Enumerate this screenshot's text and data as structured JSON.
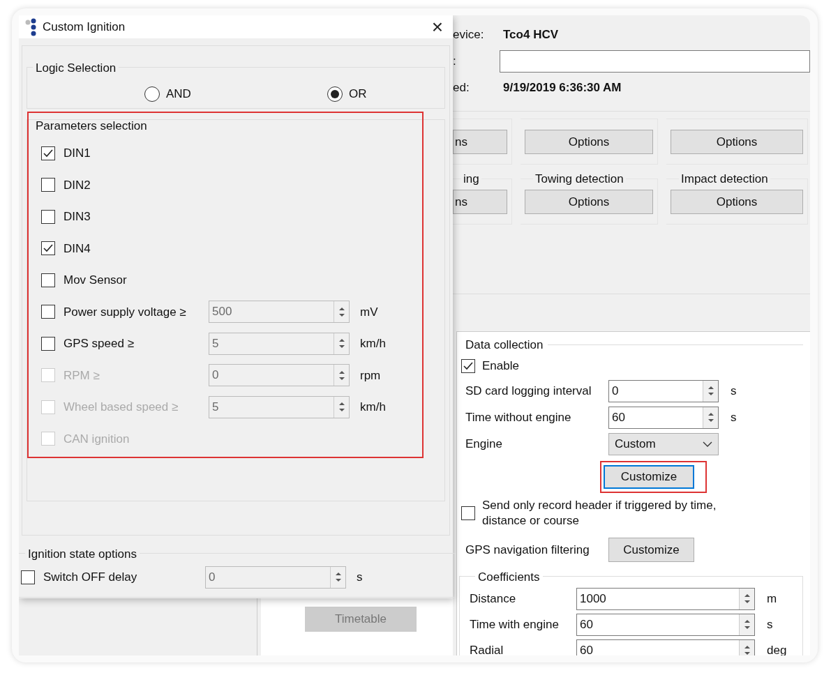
{
  "main": {
    "info": [
      {
        "kind": "text",
        "label": "evice:",
        "value": "Tco4 HCV"
      },
      {
        "kind": "input",
        "label": ":"
      },
      {
        "kind": "text",
        "label": "ed:",
        "value": "9/19/2019 6:36:30 AM"
      }
    ],
    "option_groups": [
      [
        {
          "button": "ns"
        },
        {
          "button": "Options"
        },
        {
          "button": "Options"
        }
      ],
      [
        {
          "title": "ing",
          "button": "ns"
        },
        {
          "title": "Towing detection",
          "button": "Options"
        },
        {
          "title": "Impact detection",
          "button": "Options"
        }
      ]
    ],
    "timetable": {
      "label": "Timetable",
      "disabled": true
    },
    "data_collection": {
      "title": "Data collection",
      "enable": {
        "label": "Enable",
        "checked": true
      },
      "fields": [
        {
          "kind": "spin",
          "label": "SD card logging interval",
          "value": "0",
          "unit": "s"
        },
        {
          "kind": "spin",
          "label": "Time without engine",
          "value": "60",
          "unit": "s"
        },
        {
          "kind": "combo",
          "label": "Engine",
          "value": "Custom"
        },
        {
          "kind": "button",
          "label": "Customize",
          "focused": true,
          "highlighted": true
        }
      ],
      "record_header": {
        "label": "Send only record header if triggered by time, distance or course",
        "checked": false
      },
      "gps_filtering": {
        "label": "GPS navigation filtering",
        "button": "Customize"
      },
      "coefficients": {
        "title": "Coefficients",
        "fields": [
          {
            "label": "Distance",
            "value": "1000",
            "unit": "m"
          },
          {
            "label": "Time with engine",
            "value": "60",
            "unit": "s"
          },
          {
            "label": "Radial",
            "value": "60",
            "unit": "deg"
          }
        ]
      }
    }
  },
  "dialog": {
    "title": "Custom Ignition",
    "close": "×",
    "logic": {
      "title": "Logic Selection",
      "options": [
        {
          "label": "AND",
          "selected": false
        },
        {
          "label": "OR",
          "selected": true
        }
      ]
    },
    "parameters": {
      "title": "Parameters selection",
      "highlighted": true,
      "items": [
        {
          "label": "DIN1",
          "checked": true,
          "disabled": false
        },
        {
          "label": "DIN2",
          "checked": false,
          "disabled": false
        },
        {
          "label": "DIN3",
          "checked": false,
          "disabled": false
        },
        {
          "label": "DIN4",
          "checked": true,
          "disabled": false
        },
        {
          "label": "Mov Sensor",
          "checked": false,
          "disabled": false
        },
        {
          "label": "Power supply voltage ≥",
          "checked": false,
          "disabled": false,
          "value": "500",
          "unit": "mV",
          "field_disabled": true
        },
        {
          "label": "GPS speed ≥",
          "checked": false,
          "disabled": false,
          "value": "5",
          "unit": "km/h",
          "field_disabled": true
        },
        {
          "label": "RPM ≥",
          "checked": false,
          "disabled": true,
          "value": "0",
          "unit": "rpm",
          "field_disabled": true
        },
        {
          "label": "Wheel based speed ≥",
          "checked": false,
          "disabled": true,
          "value": "5",
          "unit": "km/h",
          "field_disabled": true
        },
        {
          "label": "CAN ignition",
          "checked": false,
          "disabled": true
        }
      ]
    },
    "ignition_state": {
      "title": "Ignition state options",
      "items": [
        {
          "label": "Switch OFF delay",
          "checked": false,
          "disabled": false,
          "value": "0",
          "unit": "s",
          "field_disabled": true
        }
      ]
    }
  }
}
